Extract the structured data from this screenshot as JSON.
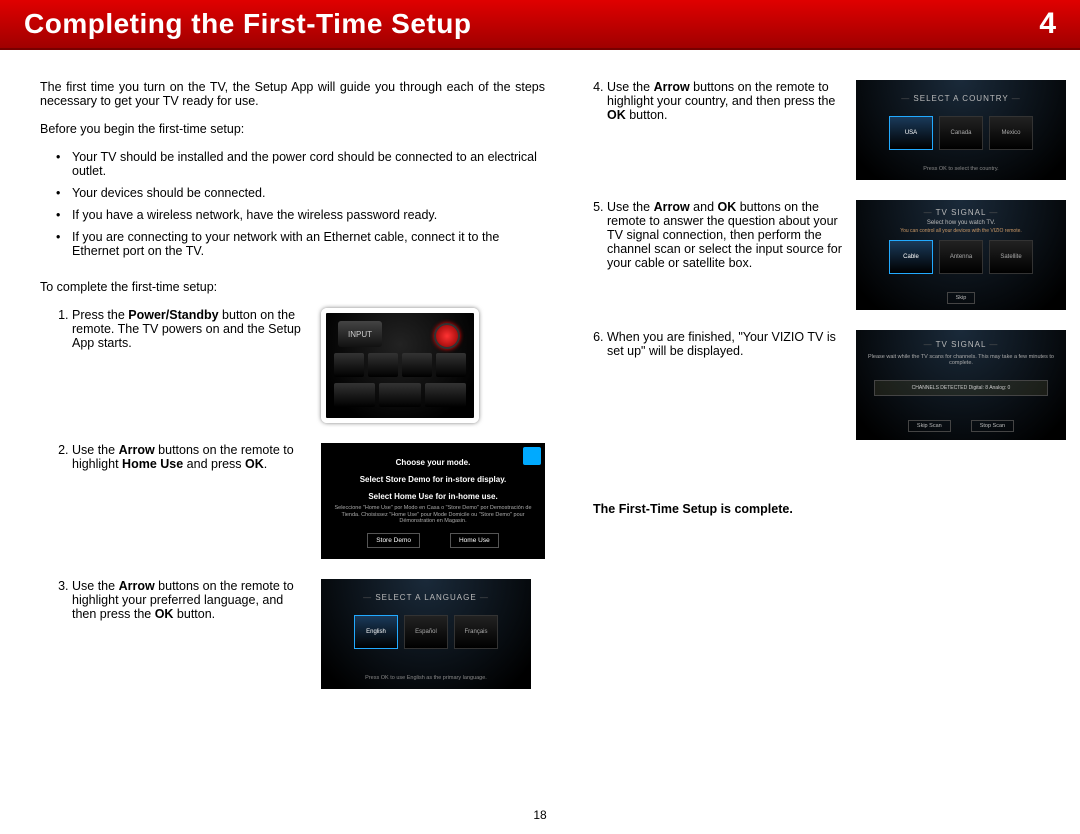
{
  "header": {
    "title": "Completing the First-Time Setup",
    "chapter": "4"
  },
  "intro": "The first time you turn on the TV, the Setup App will guide you through each of the steps necessary to get your TV ready for use.",
  "before_label": "Before you begin the first-time setup:",
  "prep": [
    "Your TV should be installed and the power cord should be connected to an electrical outlet.",
    "Your devices should be connected.",
    "If you have a wireless network, have the wireless password ready.",
    "If you are connecting to your network with an Ethernet cable, connect it to the Ethernet port on the TV."
  ],
  "to_complete": "To complete the first-time setup:",
  "steps_left": {
    "s1_pre": "Press the ",
    "s1_bold": "Power/Standby",
    "s1_post": " button on the remote. The TV powers on and the Setup App starts.",
    "s2_a": "Use the ",
    "s2_b": "Arrow",
    "s2_c": " buttons on the remote to highlight ",
    "s2_d": "Home Use",
    "s2_e": " and press ",
    "s2_f": "OK",
    "s2_g": ".",
    "s3_a": "Use the ",
    "s3_b": "Arrow",
    "s3_c": " buttons on the remote to highlight your preferred language, and then press the ",
    "s3_d": "OK",
    "s3_e": " button."
  },
  "steps_right": {
    "s4_a": "Use the ",
    "s4_b": "Arrow",
    "s4_c": " buttons on the remote to highlight your country, and then press the ",
    "s4_d": "OK",
    "s4_e": " button.",
    "s5_a": "Use the ",
    "s5_b": "Arrow",
    "s5_c": " and ",
    "s5_d": "OK",
    "s5_e": " buttons on the remote to answer the question about your TV signal connection, then perform the channel scan or select the input source for your cable or satellite box.",
    "s6": "When you are finished, \"Your VIZIO TV is set up\" will be displayed."
  },
  "complete": "The First-Time Setup is complete.",
  "page_number": "18",
  "fig_remote": {
    "input": "INPUT"
  },
  "fig_mode": {
    "t1": "Choose your mode.",
    "t2": "Select Store Demo for in-store display.",
    "t3": "Select Home Use for in-home use.",
    "sub": "Seleccione \"Home Use\" por Modo en Casa o \"Store Demo\" por Demostración de Tienda. Choisissez \"Home Use\" pour Mode Domicile ou \"Store Demo\" pour Démonstration en Magasin.",
    "btn1": "Store Demo",
    "btn2": "Home Use"
  },
  "fig_lang": {
    "title": "SELECT A LANGUAGE",
    "opts": [
      "English",
      "Español",
      "Français"
    ],
    "foot": "Press OK to use English as the primary language."
  },
  "fig_country": {
    "title": "SELECT A COUNTRY",
    "opts": [
      "USA",
      "Canada",
      "Mexico"
    ],
    "foot": "Press OK to select the country."
  },
  "fig_signal": {
    "title": "TV SIGNAL",
    "sub": "Select how you watch TV.",
    "sub2": "You can control all your devices with the VIZIO remote.",
    "opts": [
      "Cable",
      "Antenna",
      "Satellite"
    ],
    "skip": "Skip"
  },
  "fig_setup": {
    "title": "TV SIGNAL",
    "sub": "Please wait while the TV scans for channels. This may take a few minutes to complete.",
    "bar": "CHANNELS DETECTED    Digital: 8   Analog: 0",
    "btn1": "Skip Scan",
    "btn2": "Stop Scan"
  }
}
